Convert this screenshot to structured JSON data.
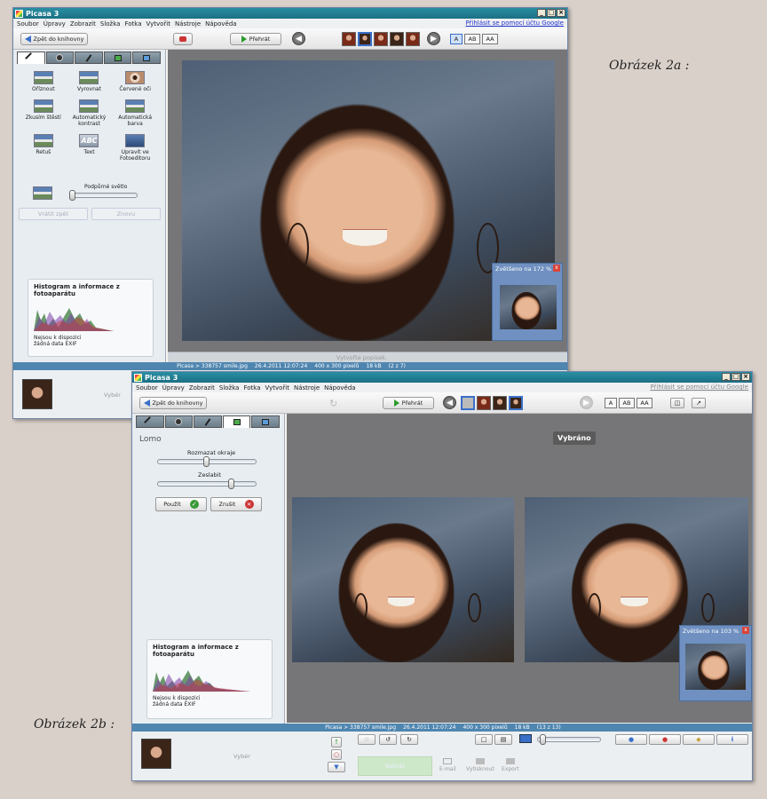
{
  "captions": {
    "a": "Obrázek 2a :",
    "b": "Obrázek 2b :"
  },
  "app_title": "Picasa 3",
  "window_buttons": [
    "_",
    "□",
    "×"
  ],
  "menu": [
    "Soubor",
    "Úpravy",
    "Zobrazit",
    "Složka",
    "Fotka",
    "Vytvořit",
    "Nástroje",
    "Nápověda"
  ],
  "signin_link": "Přihlásit se pomocí účtu Google",
  "toolbar": {
    "back_label": "Zpět do knihovny",
    "play_label": "Přehrát",
    "caption_modes": [
      "A",
      "AB",
      "AA"
    ]
  },
  "tools": [
    {
      "label": "Oříznout",
      "icon": "crop-icon"
    },
    {
      "label": "Vyrovnat",
      "icon": "straighten-icon"
    },
    {
      "label": "Červené oči",
      "icon": "redeye-icon"
    },
    {
      "label": "Zkusím štěstí",
      "icon": "feeling-lucky-icon"
    },
    {
      "label": "Automatický kontrast",
      "icon": "auto-contrast-icon"
    },
    {
      "label": "Automatická barva",
      "icon": "auto-color-icon"
    },
    {
      "label": "Retuš",
      "icon": "retouch-icon"
    },
    {
      "label": "Text",
      "icon": "text-icon",
      "icon_text": "ABC"
    },
    {
      "label": "Upravit ve Fotoeditoru",
      "icon": "photo-editor-icon"
    }
  ],
  "fill_light": {
    "label": "Podpůrné světlo",
    "value": 0
  },
  "undo_label": "Vrátit zpět",
  "redo_label": "Znovu",
  "histogram": {
    "title": "Histogram a informace z fotoaparátu",
    "note": "Nejsou k dispozici žádná data EXIF"
  },
  "status": {
    "path": "Picasa > 338757 smile.jpg",
    "datetime": "26.4.2011 12:07:24",
    "dims": "400 x 300 pixelů",
    "size": "18 kB",
    "pos_a": "(2 z 7)",
    "pos_b": "(13 z 13)"
  },
  "caption_placeholder": "Vytvořte popisek.",
  "zoom_a": "Zvětšeno na 172 %",
  "zoom_b": "Zvětšeno na 103 %",
  "tray_label": "Vybér",
  "lomo": {
    "title": "Lomo",
    "blur_label": "Rozmazat okraje",
    "blur_value": 0.5,
    "weaken_label": "Zeslabit",
    "weaken_value": 0.75,
    "apply_label": "Použít",
    "cancel_label": "Zrušit"
  },
  "selected_label": "Vybráno",
  "share": {
    "upload": "Nahrát",
    "email": "E-mail",
    "print": "Vytisknout",
    "export": "Export"
  }
}
